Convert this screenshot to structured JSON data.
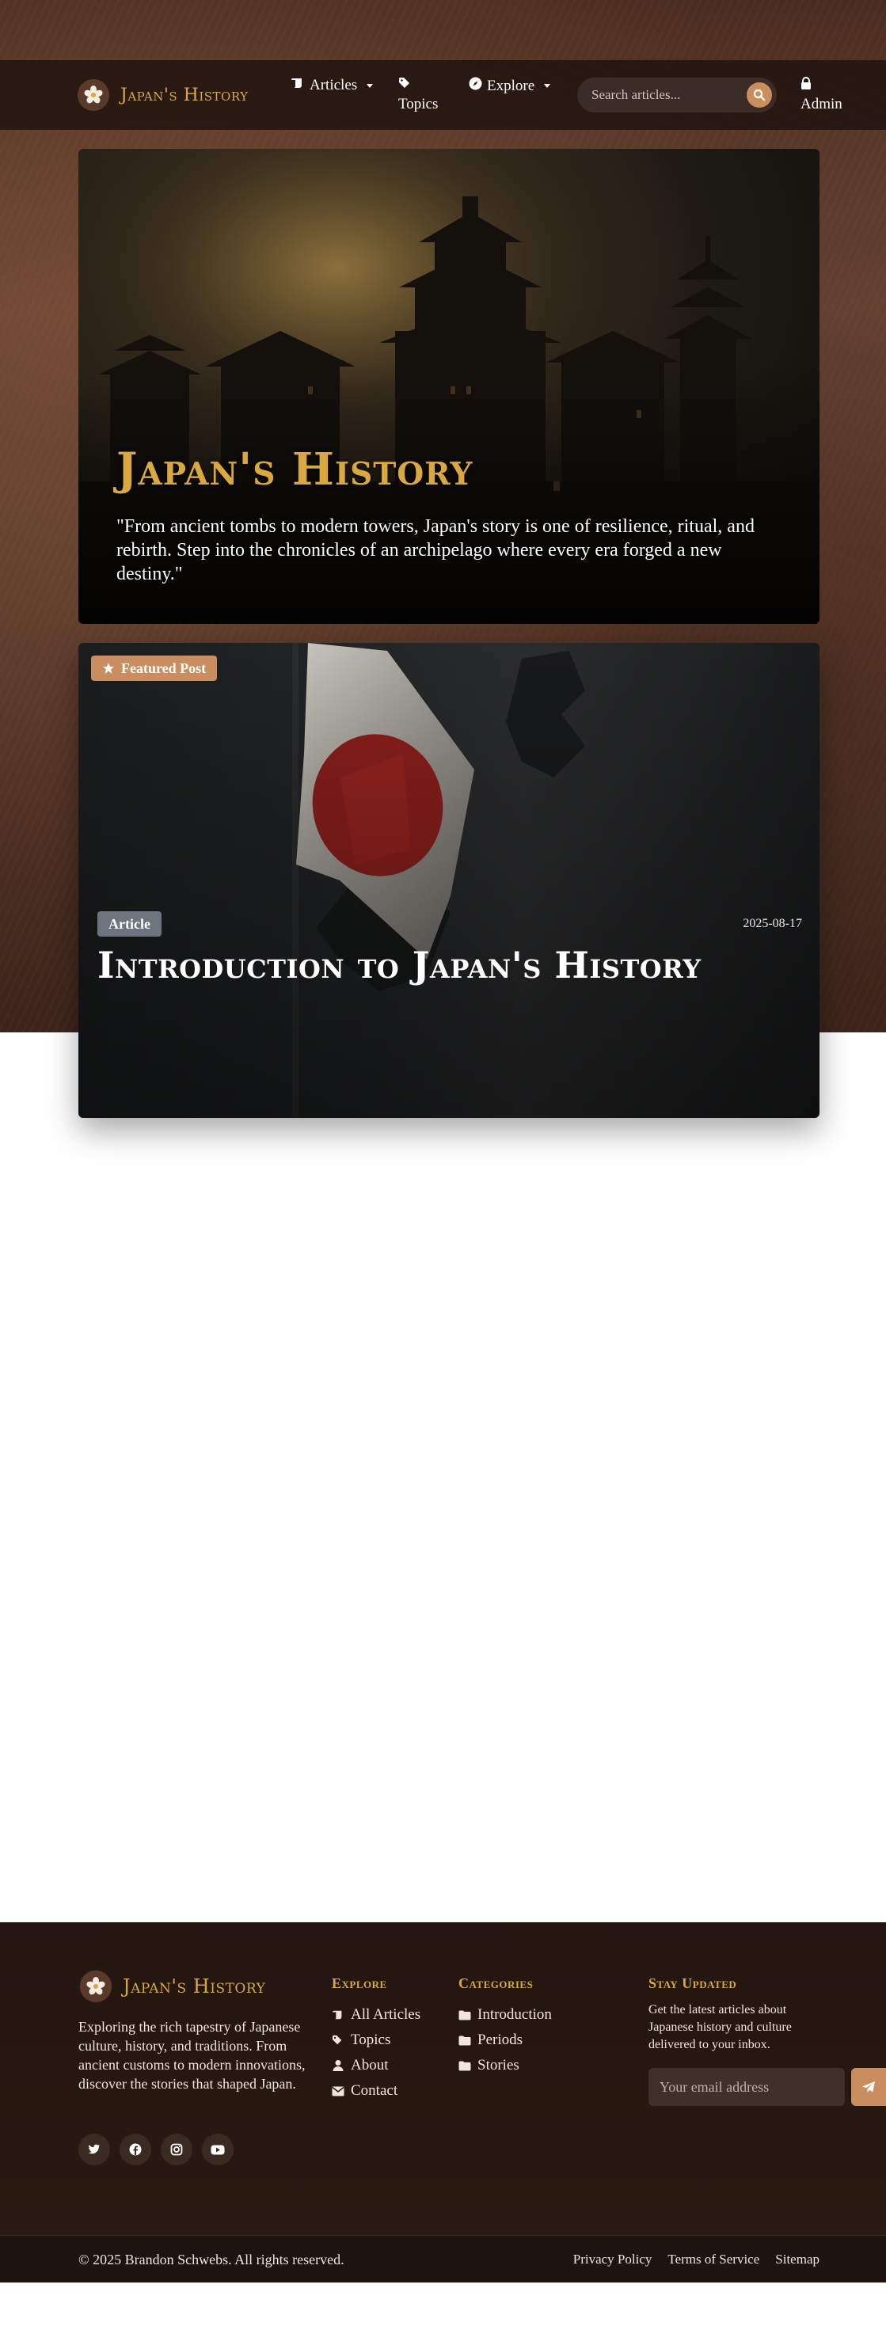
{
  "site": {
    "brand": "Japan's History"
  },
  "nav": {
    "articles": "Articles",
    "topics": "Topics",
    "explore": "Explore",
    "search_placeholder": "Search articles...",
    "admin": "Admin"
  },
  "hero": {
    "title": "Japan's History",
    "quote": "\"From ancient tombs to modern towers, Japan's story is one of resilience, ritual, and rebirth. Step into the chronicles of an archipelago where every era forged a new destiny.\""
  },
  "featured": {
    "badge": "Featured Post",
    "category": "Article",
    "date": "2025-08-17",
    "title": "Introduction to Japan's History"
  },
  "footer": {
    "brand": "Japan's History",
    "about": "Exploring the rich tapestry of Japanese culture, history, and traditions. From ancient customs to modern innovations, discover the stories that shaped Japan.",
    "explore_heading": "Explore",
    "explore_links": [
      "All Articles",
      "Topics",
      "About",
      "Contact"
    ],
    "categories_heading": "Categories",
    "categories_links": [
      "Introduction",
      "Periods",
      "Stories"
    ],
    "newsletter_heading": "Stay Updated",
    "newsletter_text": "Get the latest articles about Japanese history and culture delivered to your inbox.",
    "email_placeholder": "Your email address",
    "copyright": "© 2025 Brandon Schwebs. All rights reserved.",
    "bottom_links": [
      "Privacy Policy",
      "Terms of Service",
      "Sitemap"
    ]
  },
  "social_icons": [
    "twitter-icon",
    "facebook-icon",
    "instagram-icon",
    "youtube-icon"
  ],
  "colors": {
    "accent_gold": "#d9a940",
    "accent_copper": "#c98d5f",
    "nav_bg": "#22140f",
    "footer_bg": "#23150f",
    "badge_gray": "#6c757d"
  }
}
